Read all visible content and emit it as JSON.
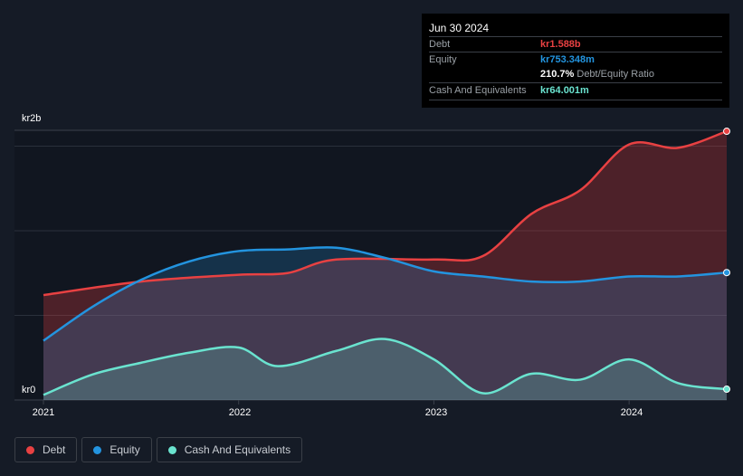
{
  "tooltip": {
    "date": "Jun 30 2024",
    "debt_label": "Debt",
    "debt_value": "kr1.588b",
    "equity_label": "Equity",
    "equity_value": "kr753.348m",
    "ratio_value": "210.7%",
    "ratio_label": "Debt/Equity Ratio",
    "cash_label": "Cash And Equivalents",
    "cash_value": "kr64.001m"
  },
  "chart_data": {
    "type": "area",
    "y_tick_labels": [
      "kr2b",
      "kr0"
    ],
    "x_tick_labels": [
      "2021",
      "2022",
      "2023",
      "2024"
    ],
    "xlim": [
      2021,
      2024.5
    ],
    "unit": "kr billions",
    "grid": true,
    "legend_placement": "bottom-left",
    "series": [
      {
        "name": "Debt",
        "color": "#e84142",
        "x": [
          2021,
          2021.5,
          2022,
          2022.25,
          2022.5,
          2023,
          2023.25,
          2023.5,
          2023.75,
          2024,
          2024.25,
          2024.5
        ],
        "values": [
          0.62,
          0.7,
          0.74,
          0.75,
          0.83,
          0.83,
          0.85,
          1.1,
          1.24,
          1.51,
          1.49,
          1.588
        ]
      },
      {
        "name": "Equity",
        "color": "#2394df",
        "x": [
          2021,
          2021.25,
          2021.5,
          2021.75,
          2022,
          2022.25,
          2022.5,
          2022.75,
          2023,
          2023.25,
          2023.5,
          2023.75,
          2024,
          2024.25,
          2024.5
        ],
        "values": [
          0.35,
          0.55,
          0.71,
          0.82,
          0.88,
          0.89,
          0.9,
          0.84,
          0.76,
          0.73,
          0.7,
          0.7,
          0.73,
          0.73,
          0.753
        ]
      },
      {
        "name": "Cash And Equivalents",
        "color": "#6ae3cf",
        "x": [
          2021,
          2021.25,
          2021.5,
          2021.75,
          2022,
          2022.2,
          2022.5,
          2022.75,
          2023,
          2023.25,
          2023.5,
          2023.75,
          2024,
          2024.25,
          2024.5
        ],
        "values": [
          0.03,
          0.15,
          0.22,
          0.28,
          0.31,
          0.2,
          0.29,
          0.36,
          0.24,
          0.04,
          0.155,
          0.12,
          0.24,
          0.1,
          0.064
        ]
      }
    ]
  }
}
